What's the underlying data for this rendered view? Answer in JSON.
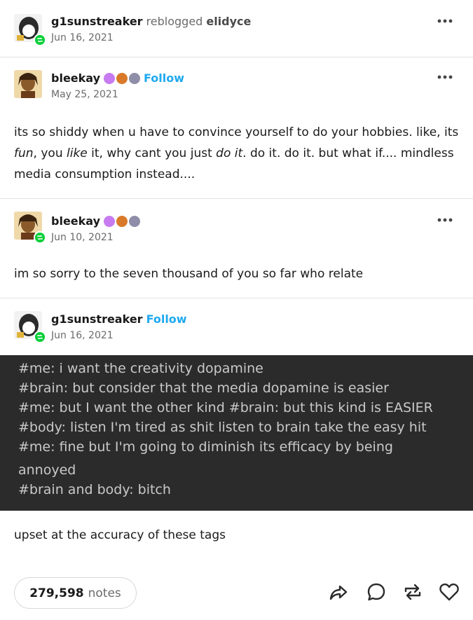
{
  "header": {
    "username": "g1sunstreaker",
    "action_text": "reblogged",
    "source_username": "elidyce",
    "date": "Jun 16, 2021",
    "more_label": "•••"
  },
  "posts": [
    {
      "username": "bleekay",
      "follow_label": "Follow",
      "date": "May 25, 2021",
      "more_label": "•••",
      "body_parts": {
        "p1": "its so shiddy when u have to convince yourself to do your hobbies. like, its ",
        "em1": "fun",
        "p2": ", you ",
        "em2": "like",
        "p3": " it, why cant you just ",
        "em3": "do it",
        "p4": ". do it. do it. but what if.... mindless media consumption instead...."
      }
    },
    {
      "username": "bleekay",
      "date": "Jun 10, 2021",
      "more_label": "•••",
      "body": "im so sorry to the seven thousand of you so far who relate"
    },
    {
      "username": "g1sunstreaker",
      "follow_label": "Follow",
      "date": "Jun 16, 2021",
      "tags_image_lines": [
        "#me: i want the creativity dopamine",
        "#brain: but consider that the media dopamine is easier",
        "#me: but I want the other kind    #brain: but this kind is EASIER",
        "#body: listen I'm tired as shit listen to brain take the easy hit",
        "#me: fine but I'm going to diminish its efficacy by being",
        "annoyed",
        "#brain and body: bitch"
      ],
      "body": "upset at the accuracy of these tags"
    }
  ],
  "footer": {
    "notes_count": "279,598",
    "notes_label": "notes"
  },
  "icons": {
    "share": "share-icon",
    "reply": "reply-icon",
    "reblog": "reblog-icon",
    "like": "heart-icon"
  },
  "colors": {
    "follow": "#1fa9f1",
    "reblog_badge": "#00cf35",
    "tag_block_bg": "#2b2b2b"
  }
}
